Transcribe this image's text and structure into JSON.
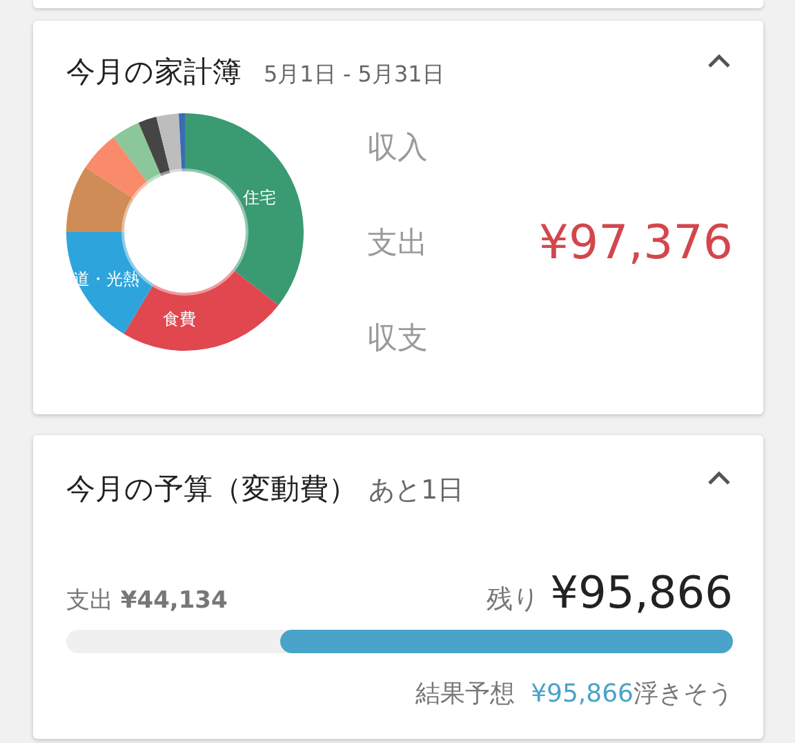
{
  "household": {
    "title": "今月の家計簿",
    "period": "5月1日 - 5月31日",
    "expanded": true,
    "donut": {
      "segments": [
        {
          "label": "住宅",
          "color": "#3a9a72"
        },
        {
          "label": "食費",
          "color": "#e0474f"
        },
        {
          "label": "道・光熱",
          "color": "#2ea4dc"
        },
        {
          "color": "#d08c56"
        },
        {
          "color": "#f98a6a"
        },
        {
          "color": "#8bc79a"
        },
        {
          "color": "#454545"
        },
        {
          "color": "#bdbdbd"
        },
        {
          "color": "#3a6bb5"
        }
      ]
    },
    "rows": [
      {
        "label": "収入"
      },
      {
        "label": "支出",
        "amount": "¥97,376"
      },
      {
        "label": "収支"
      }
    ]
  },
  "budget": {
    "title": "今月の予算（変動費）",
    "remaining_days": "あと1日",
    "expanded": true,
    "spent_label": "支出",
    "spent": "¥44,134",
    "left_label": "残り",
    "left": "¥95,866",
    "level": 0.68,
    "forecast_label": "結果予想",
    "forecast_amount": "¥95,866",
    "forecast_suffix": "浮きそう"
  }
}
